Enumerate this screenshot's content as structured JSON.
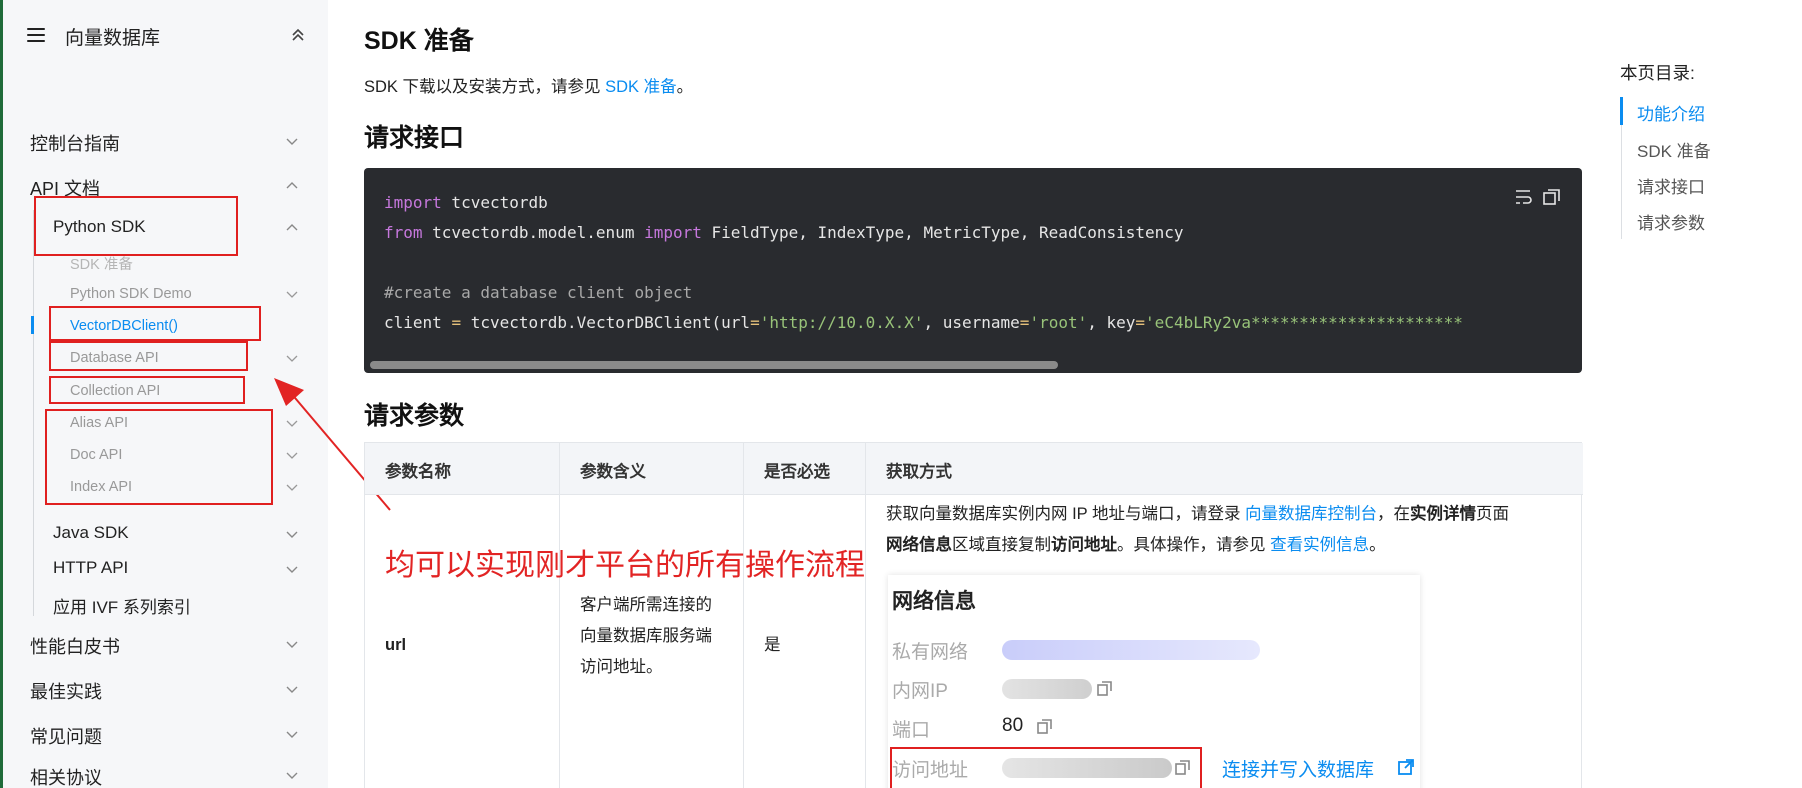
{
  "sidebar": {
    "title": "向量数据库",
    "items": [
      {
        "label": "控制台指南"
      },
      {
        "label": "API 文档"
      },
      {
        "label": "Python SDK"
      },
      {
        "label": "SDK 准备"
      },
      {
        "label": "Python SDK Demo"
      },
      {
        "label": "VectorDBClient()"
      },
      {
        "label": "Database API"
      },
      {
        "label": "Collection API"
      },
      {
        "label": "Alias API"
      },
      {
        "label": "Doc API"
      },
      {
        "label": "Index API"
      },
      {
        "label": "Java SDK"
      },
      {
        "label": "HTTP API"
      },
      {
        "label": "应用 IVF 系列索引"
      },
      {
        "label": "性能白皮书"
      },
      {
        "label": "最佳实践"
      },
      {
        "label": "常见问题"
      },
      {
        "label": "相关协议"
      }
    ]
  },
  "main": {
    "sdk_heading": "SDK 准备",
    "sdk_para_prefix": "SDK 下载以及安装方式，请参见 ",
    "sdk_para_link": "SDK 准备",
    "sdk_para_suffix": "。",
    "request_heading": "请求接口",
    "code": {
      "l1_kw": "import",
      "l1_rest": " tcvectordb",
      "l2_kw1": "from",
      "l2_mid": " tcvectordb.model.enum ",
      "l2_kw2": "import",
      "l2_rest": " FieldType, IndexType, MetricType, ReadConsistency",
      "l3": "#create a database client object",
      "l4_a": "client ",
      "l4_eq1": "=",
      "l4_b": " tcvectordb.VectorDBClient(url",
      "l4_eq2": "=",
      "l4_url": "'http://10.0.X.X'",
      "l4_c": ", username",
      "l4_eq3": "=",
      "l4_user": "'root'",
      "l4_d": ", key",
      "l4_eq4": "=",
      "l4_key": "'eC4bLRy2va**********************"
    },
    "params_heading": "请求参数",
    "table": {
      "headers": [
        "参数名称",
        "参数含义",
        "是否必选",
        "获取方式"
      ],
      "row": {
        "name": "url",
        "meaning_1": "客户端所需连接的",
        "meaning_2": "向量数据库服务端",
        "meaning_3": "访问地址。",
        "required": "是",
        "how_1_a": "获取向量数据库实例内网 IP 地址与端口，请登录 ",
        "how_1_link": "向量数据库控制台",
        "how_1_b": "，在",
        "how_1_bold": "实例详情",
        "how_1_c": "页面",
        "how_2_bold1": "网络信息",
        "how_2_a": "区域直接复制",
        "how_2_bold2": "访问地址",
        "how_2_b": "。具体操作，请参见 ",
        "how_2_link": "查看实例信息",
        "how_2_c": "。"
      }
    },
    "network_panel": {
      "title": "网络信息",
      "private_network": "私有网络",
      "internal_ip": "内网IP",
      "port_label": "端口",
      "port_value": "80",
      "access_address": "访问地址",
      "connect_link": "连接并写入数据库"
    },
    "annotation": "均可以实现刚才平台的所有操作流程"
  },
  "toc": {
    "title": "本页目录:",
    "items": [
      "功能介绍",
      "SDK 准备",
      "请求接口",
      "请求参数"
    ]
  },
  "colors": {
    "accent": "#0a8cf0",
    "annotation_red": "#e22424",
    "code_bg": "#292b2f"
  }
}
